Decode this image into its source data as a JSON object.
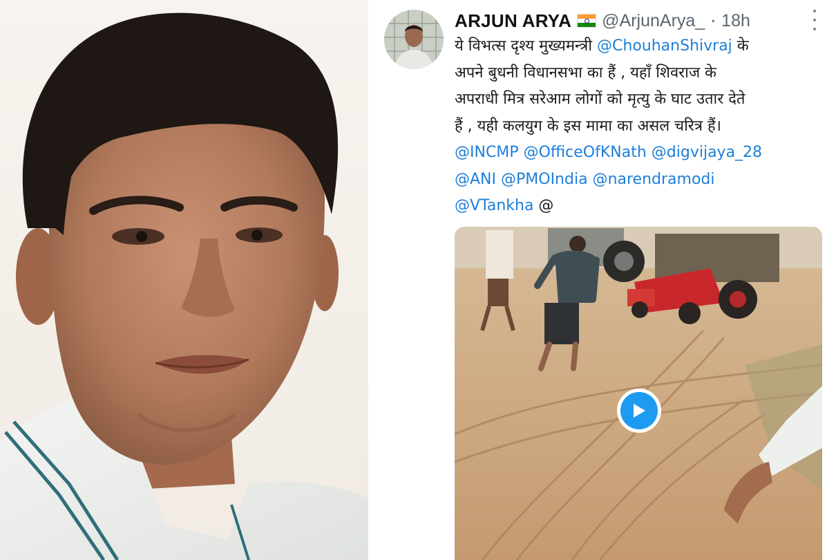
{
  "tweet": {
    "author_name": "ARJUN ARYA",
    "flag_icon": "india-flag-icon",
    "handle": "@ArjunArya_",
    "separator": "·",
    "time": "18h",
    "menu_icon": "more-vertical-icon",
    "lines": [
      {
        "parts": [
          {
            "text": "ये विभत्स दृश्य मुख्यमन्त्री ",
            "type": "text"
          },
          {
            "text": "@ChouhanShivraj",
            "type": "mention"
          },
          {
            "text": " के",
            "type": "text"
          }
        ]
      },
      {
        "parts": [
          {
            "text": "अपने बुधनी विधानसभा का हैं , यहाँ शिवराज के",
            "type": "text"
          }
        ]
      },
      {
        "parts": [
          {
            "text": "अपराधी मित्र सरेआम लोगों को मृत्यु के घाट उतार देते",
            "type": "text"
          }
        ]
      },
      {
        "parts": [
          {
            "text": "हैं , यही कलयुग के इस मामा का असल चरित्र हैं।",
            "type": "text"
          }
        ]
      },
      {
        "parts": [
          {
            "text": "@INCMP",
            "type": "mention"
          },
          {
            "text": " ",
            "type": "text"
          },
          {
            "text": "@OfficeOfKNath",
            "type": "mention"
          },
          {
            "text": " ",
            "type": "text"
          },
          {
            "text": "@digvijaya_28",
            "type": "mention"
          }
        ]
      },
      {
        "parts": [
          {
            "text": "@ANI",
            "type": "mention"
          },
          {
            "text": " ",
            "type": "text"
          },
          {
            "text": "@PMOIndia",
            "type": "mention"
          },
          {
            "text": " ",
            "type": "text"
          },
          {
            "text": "@narendramodi",
            "type": "mention"
          }
        ]
      },
      {
        "parts": [
          {
            "text": "@VTankha",
            "type": "mention"
          },
          {
            "text": " @",
            "type": "text"
          }
        ]
      }
    ],
    "media": {
      "play_icon": "play-icon"
    }
  },
  "colors": {
    "mention": "#1d7fd8",
    "play_button": "#1d9bf0",
    "meta_text": "#5b6670"
  }
}
